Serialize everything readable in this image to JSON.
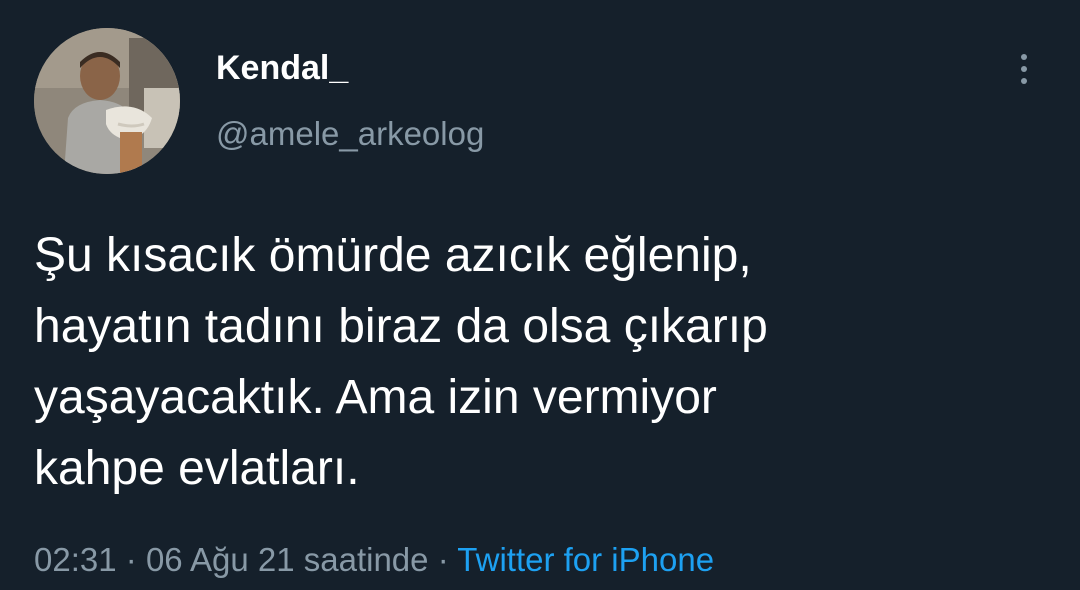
{
  "user": {
    "display_name": "Kendal_",
    "handle": "@amele_arkeolog"
  },
  "menu": {
    "icon": "more-vertical-icon"
  },
  "tweet": {
    "lines": [
      "Şu kısacık ömürde azıcık eğlenip,",
      "hayatın tadını biraz da olsa çıkarıp",
      "yaşayacaktık. Ama izin vermiyor",
      "kahpe evlatları."
    ]
  },
  "meta": {
    "time": "02:31",
    "separator1": "·",
    "date": "06 Ağu 21 saatinde",
    "separator2": "·",
    "source": "Twitter for iPhone"
  },
  "colors": {
    "background": "#15202b",
    "text": "#ffffff",
    "secondary": "#8899a6",
    "accent": "#1da1f2"
  }
}
